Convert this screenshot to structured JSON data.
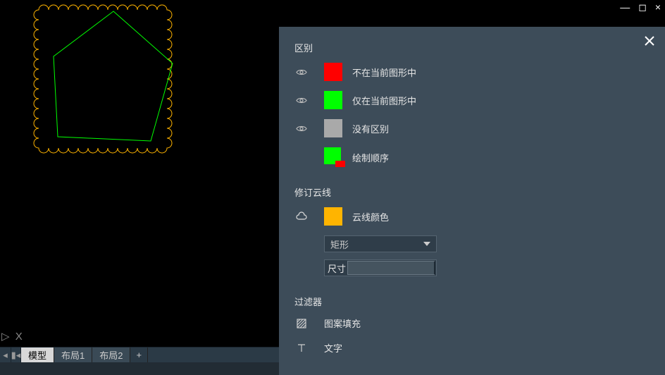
{
  "window_controls": {
    "min": "—",
    "max": "◻",
    "close": "×"
  },
  "ucs": {
    "arrow": "▷",
    "axis": "X"
  },
  "tabs": {
    "prev": "◂",
    "first": "▮◂",
    "model": "模型",
    "layout1": "布局1",
    "layout2": "布局2",
    "add": "+"
  },
  "panel": {
    "sections": {
      "difference": {
        "title": "区别",
        "items": {
          "not_in_current": "不在当前图形中",
          "only_in_current": "仅在当前图形中",
          "no_difference": "没有区别",
          "draw_order": "绘制顺序"
        }
      },
      "revision_cloud": {
        "title": "修订云线",
        "cloud_color": "云线颜色",
        "shape_dropdown": "矩形",
        "size_prefix": "尺寸",
        "size_value": ""
      },
      "filter": {
        "title": "过滤器",
        "hatch": "图案填充",
        "text": "文字"
      }
    },
    "colors": {
      "not_in_current": "#ff0000",
      "only_in_current": "#00ff00",
      "no_difference": "#a9a9a9",
      "cloud": "#ffb400"
    }
  }
}
